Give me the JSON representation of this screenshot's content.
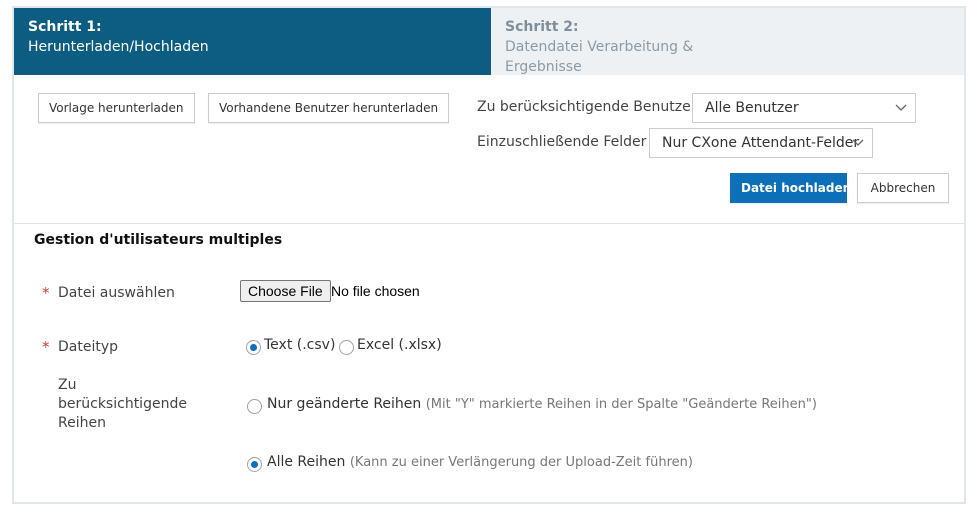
{
  "steps": [
    {
      "number": "Schritt 1:",
      "label": "Herunterladen/Hochladen",
      "active": true
    },
    {
      "number": "Schritt 2:",
      "label": "Datendatei Verarbeitung & Ergebnisse",
      "active": false
    }
  ],
  "toolbar": {
    "download_template": "Vorlage herunterladen",
    "download_users": "Vorhandene Benutzer herunterladen",
    "users_label": "Zu berücksichtigende Benutzer",
    "users_value": "Alle Benutzer",
    "fields_label": "Einzuschließende Felder",
    "fields_value": "Nur CXone Attendant-Felder",
    "upload_button": "Datei hochladen",
    "cancel_button": "Abbrechen"
  },
  "form": {
    "title": "Gestion d'utilisateurs multiples",
    "required_mark": "*",
    "file_label": "Datei auswählen",
    "file_button": "Choose File",
    "file_status": "No file chosen",
    "filetype_label": "Dateityp",
    "filetype_options": [
      {
        "label": "Text (.csv)",
        "checked": true
      },
      {
        "label": "Excel (.xlsx)",
        "checked": false
      }
    ],
    "rows_label": "Zu berücksichtigende Reihen",
    "rows_options": [
      {
        "label": "Nur geänderte Reihen",
        "hint": "(Mit \"Y\" markierte Reihen in der Spalte \"Geänderte Reihen\")",
        "checked": false
      },
      {
        "label": "Alle Reihen",
        "hint": "(Kann zu einer Verlängerung der Upload-Zeit führen)",
        "checked": true
      }
    ]
  },
  "colors": {
    "active_step": "#0d5d83",
    "primary_button": "#0d6fb8",
    "required": "#d93b3b"
  }
}
